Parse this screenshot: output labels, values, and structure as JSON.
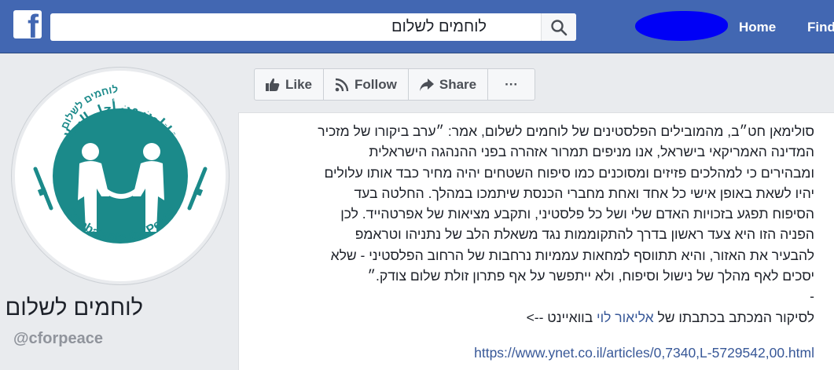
{
  "header": {
    "logo": "f",
    "search_value": "לוחמים לשלום",
    "search_icon": "search-icon",
    "nav": {
      "home": "Home",
      "find": "Find"
    }
  },
  "page": {
    "logo_text_hebrew": "לוחמים לשלום",
    "logo_text_arabic": "مقاتلون من أجل السلام",
    "logo_text_english": "Combatants for Peace",
    "name": "לוחמים לשלום",
    "handle": "@cforpeace"
  },
  "actions": {
    "like": "Like",
    "follow": "Follow",
    "share": "Share",
    "more": "···"
  },
  "post": {
    "lines": [
      "סולימאן חט״ב, מהמובילים הפלסטינים של לוחמים לשלום, אמר: ״ערב ביקורו של מזכיר",
      "המדינה האמריקאי בישראל, אנו מניפים תמרור אזהרה בפני ההנהגה הישראלית",
      "ומבהירים כי למהלכים פזיזים ומסוכנים כמו סיפוח השטחים יהיה מחיר כבד אותו עלולים",
      "יהיו לשאת באופן אישי כל אחד ואחת מחברי הכנסת שיתמכו במהלך. החלטה בעד",
      "הסיפוח תפגע בזכויות האדם שלי ושל כל פלסטיני, ותקבע מציאות של אפרטהייד. לכן",
      "הפניה הזו היא צעד ראשון בדרך להתקוממות נגד משאלת הלב של נתניהו וטראמפ",
      "להבעיר את האזור, והיא תתווסף למחאות עממיות נרחבות של הרחוב הפלסטיני - שלא",
      "יסכים לאף מהלך של נישול וסיפוח, ולא ייתפשר על אף פתרון זולת שלום צודק.״",
      "-"
    ],
    "credit_prefix": "לסיקור המכתב בכתבתו של ",
    "credit_name": "אליאור לוי",
    "credit_suffix": " בוואיינט -->",
    "url": "https://www.ynet.co.il/articles/0,7340,L-5729542,00.html"
  },
  "colors": {
    "topbar": "#4267b2",
    "logo_teal": "#1b8a8a",
    "link": "#385898"
  }
}
